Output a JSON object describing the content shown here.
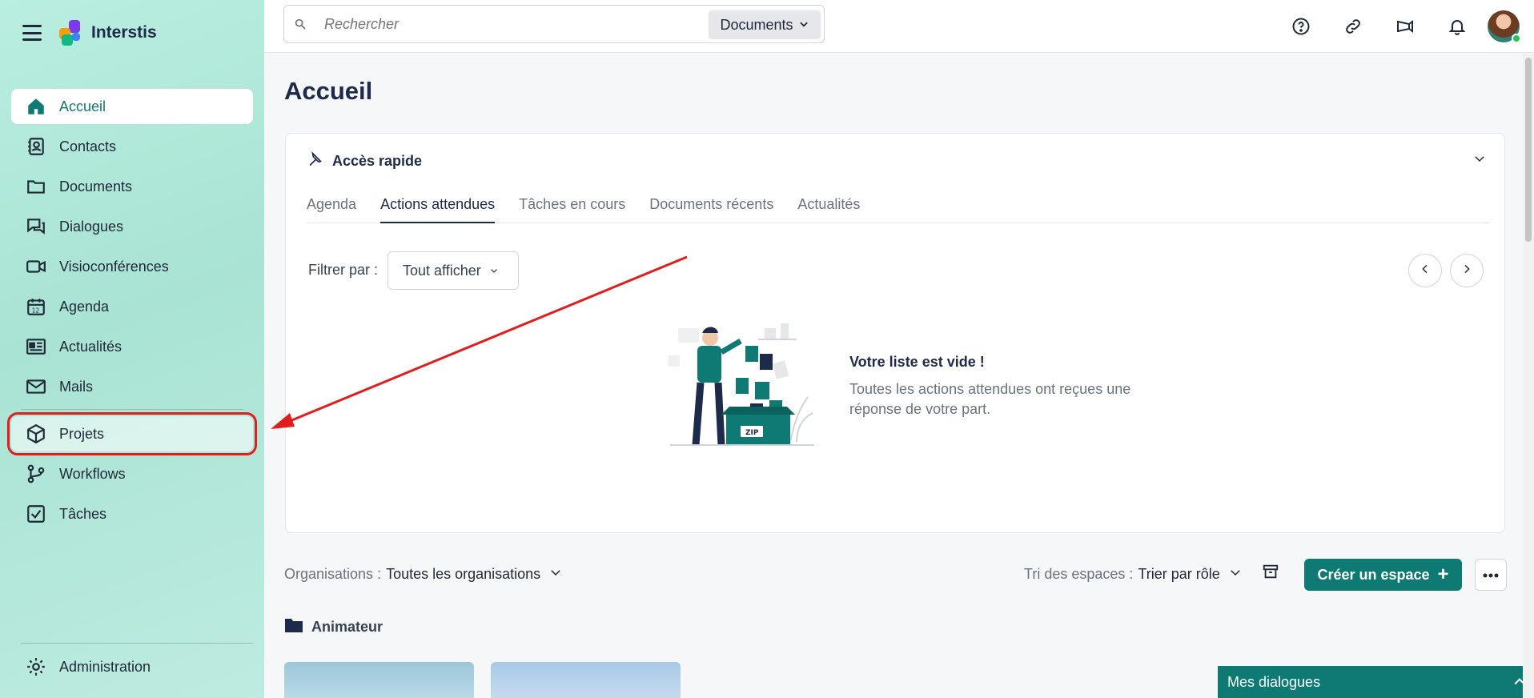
{
  "brand": {
    "name": "Interstis"
  },
  "sidebar": {
    "items": [
      {
        "label": "Accueil",
        "icon": "home-icon"
      },
      {
        "label": "Contacts",
        "icon": "contacts-icon"
      },
      {
        "label": "Documents",
        "icon": "folder-icon"
      },
      {
        "label": "Dialogues",
        "icon": "chat-icon"
      },
      {
        "label": "Visioconférences",
        "icon": "video-icon"
      },
      {
        "label": "Agenda",
        "icon": "calendar-icon"
      },
      {
        "label": "Actualités",
        "icon": "news-icon"
      },
      {
        "label": "Mails",
        "icon": "mail-icon"
      },
      {
        "label": "Projets",
        "icon": "cube-icon"
      },
      {
        "label": "Workflows",
        "icon": "workflow-icon"
      },
      {
        "label": "Tâches",
        "icon": "checkbox-icon"
      }
    ],
    "admin_label": "Administration"
  },
  "search": {
    "placeholder": "Rechercher",
    "scope": "Documents"
  },
  "page": {
    "title": "Accueil"
  },
  "quick_access": {
    "title": "Accès rapide",
    "tabs": [
      "Agenda",
      "Actions attendues",
      "Tâches en cours",
      "Documents récents",
      "Actualités"
    ],
    "active_tab": "Actions attendues",
    "filter_label": "Filtrer par :",
    "filter_value": "Tout afficher",
    "empty_title": "Votre liste est vide !",
    "empty_desc": "Toutes les actions attendues ont reçues une réponse de votre part.",
    "illustration_box_label": "ZIP"
  },
  "spaces": {
    "org_label": "Organisations :",
    "org_value": "Toutes les organisations",
    "sort_label": "Tri des espaces :",
    "sort_value": "Trier par rôle",
    "create_label": "Créer un espace",
    "section_title": "Animateur"
  },
  "dialogs_bar": {
    "label": "Mes dialogues"
  },
  "colors": {
    "accent": "#0f7a73",
    "sidebar": "#b3e8da",
    "highlight": "#e11d1d"
  }
}
